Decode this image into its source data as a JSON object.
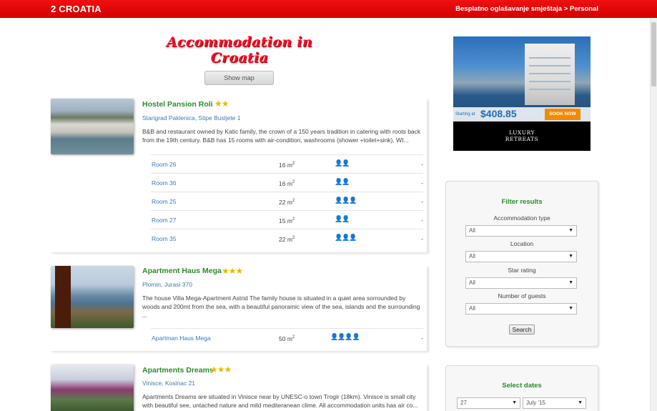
{
  "header": {
    "brand": "2 CROATIA",
    "link": "Besplatno oglašavanje smještaja > Personal"
  },
  "page_title": "Accommodation in Croatia",
  "show_map_label": "Show map",
  "properties": [
    {
      "name": "Hostel Pansion Roli",
      "stars": "★★",
      "address": "Starigrad Paklenica, Stipe Busljete 1",
      "description": "B&B and restaurant owned by Katic family, the crown of a 150 years tradition in catering with roots back from the 19th century. B&B has 15 rooms with air-condition, washrooms (shower +toilet+sink), WI...",
      "rooms": [
        {
          "name": "Room 26",
          "size": "16 m",
          "guests": "👤👤",
          "price": "-"
        },
        {
          "name": "Room 36",
          "size": "16 m",
          "guests": "👤👤",
          "price": "-"
        },
        {
          "name": "Room 25",
          "size": "22 m",
          "guests": "👤👤👤",
          "price": "-"
        },
        {
          "name": "Room 27",
          "size": "15 m",
          "guests": "👤👤",
          "price": "-"
        },
        {
          "name": "Room 35",
          "size": "22 m",
          "guests": "👤👤👤",
          "price": "-"
        }
      ]
    },
    {
      "name": "Apartment Haus Mega",
      "stars": "★★★",
      "address": "Plomin, Jurasi 370",
      "description": "The house Villa Mega-Apartment Astrid The family house is situated in a quiet area sorrounded by woods and 200mt from the sea, with a beautiful panoramic view of the sea, islands and the surrounding ...",
      "rooms": [
        {
          "name": "Apartman Haus Mega",
          "size": "50 m",
          "guests": "👤👤👤👤",
          "price": "-"
        }
      ]
    },
    {
      "name": "Apartments Dreams",
      "stars": "★★★",
      "address": "Vinisce, Kosinac 21",
      "description": "Apartments Dreams are situated in Vinisce near by UNESC-o town Trogir (18km). Vinisce is small city with beautiful see, untached nature and mild mediteranean clime. All accommodation units has air co..."
    }
  ],
  "ad": {
    "starting_at": "Starting at",
    "price": "$408.85",
    "book_now": "BOOK NOW",
    "brand_line1": "LUXURY",
    "brand_line2": "RETREATS"
  },
  "filter": {
    "title": "Filter results",
    "accommodation_type_label": "Accommodation type",
    "accommodation_type_value": "All",
    "location_label": "Location",
    "location_value": "All",
    "star_rating_label": "Star rating",
    "star_rating_value": "All",
    "guests_label": "Number of guests",
    "guests_value": "All",
    "search_label": "Search"
  },
  "dates": {
    "title": "Select dates",
    "day": "27",
    "month": "July '15"
  },
  "icons": {
    "select_arrow": "▼"
  }
}
